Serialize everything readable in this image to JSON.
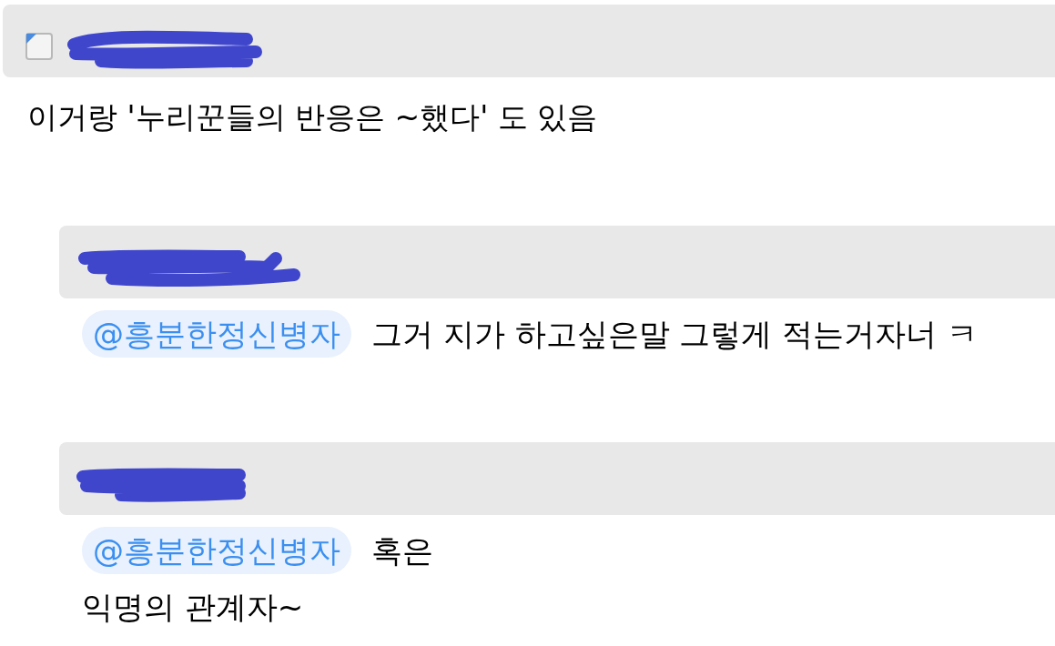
{
  "comments": [
    {
      "kind": "top",
      "redacted": true,
      "lines": [
        "이거랑 '누리꾼들의 반응은 ~했다' 도 있음"
      ]
    },
    {
      "kind": "reply",
      "redacted": true,
      "mention": "@흥분한정신병자",
      "lines": [
        "그거 지가 하고싶은말 그렇게 적는거자너 ㅋ"
      ]
    },
    {
      "kind": "reply",
      "redacted": true,
      "mention": "@흥분한정신병자",
      "lines": [
        "혹은",
        "익명의 관계자~"
      ]
    }
  ]
}
